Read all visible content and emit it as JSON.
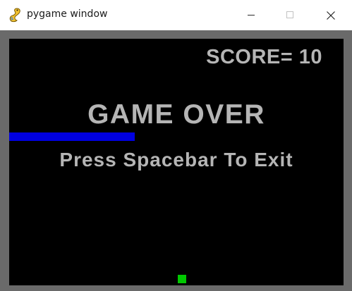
{
  "window": {
    "title": "pygame window",
    "app_icon": "pygame-snake-icon",
    "controls": {
      "minimize_icon": "minimize-icon",
      "maximize_icon": "maximize-icon",
      "close_icon": "close-icon"
    }
  },
  "game": {
    "score_text": "SCORE= 10",
    "game_over_text": "GAME OVER",
    "instruction_text": "Press Spacebar To Exit",
    "colors": {
      "frame": "#6a6a6a",
      "background": "#000000",
      "text": "#b5b5b5",
      "snake": "#0000e0",
      "food": "#00c800"
    }
  }
}
